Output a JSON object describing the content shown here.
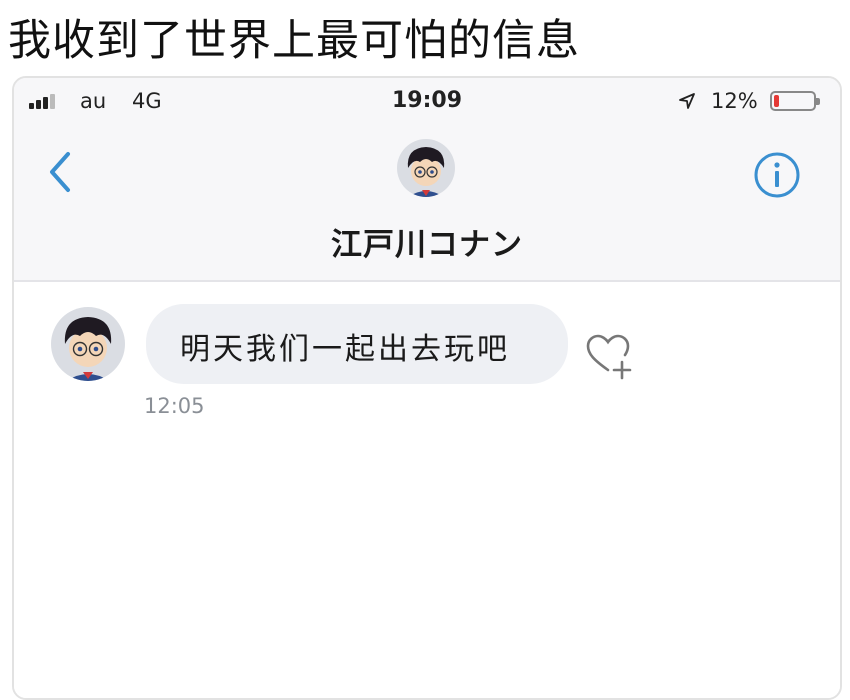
{
  "caption": "我收到了世界上最可怕的信息",
  "status_bar": {
    "carrier": "au",
    "network": "4G",
    "time": "19:09",
    "battery_percent_label": "12%",
    "battery_level": 0.12,
    "battery_color": "#e53935"
  },
  "header": {
    "contact_name": "江戸川コナン",
    "back_icon": "chevron-left-icon",
    "info_icon": "info-circle-icon",
    "accent_color": "#3a8fd0"
  },
  "messages": [
    {
      "text": "明天我们一起出去玩吧",
      "time": "12:05",
      "reaction_icon": "heart-plus-icon"
    }
  ]
}
